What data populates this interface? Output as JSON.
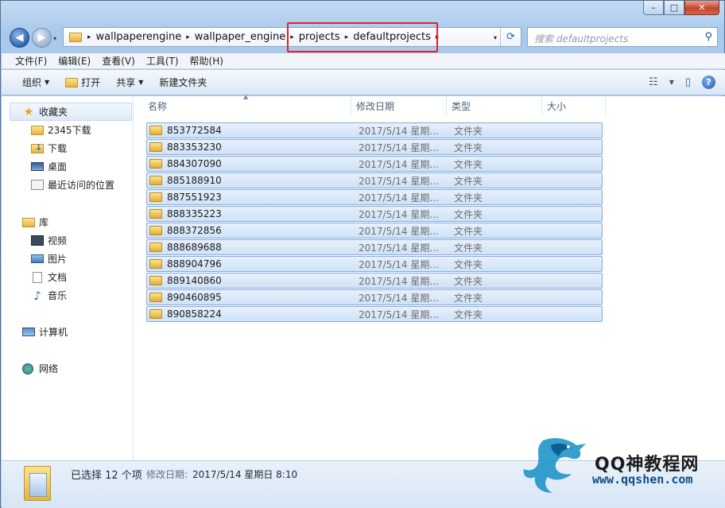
{
  "window": {
    "caption": {
      "minimize": "–",
      "maximize": "□",
      "close": "✕"
    }
  },
  "navigation": {
    "back": "◀",
    "forward": "▶",
    "history": "▾",
    "breadcrumbs": [
      "wallpaperengine",
      "wallpaper_engine",
      "projects",
      "defaultprojects"
    ],
    "separator": "▸",
    "dropdown": "▾",
    "refresh": "⟳",
    "search_placeholder": "搜索 defaultprojects"
  },
  "menubar": [
    "文件(F)",
    "编辑(E)",
    "查看(V)",
    "工具(T)",
    "帮助(H)"
  ],
  "commandbar": {
    "organize": "组织",
    "open": "打开",
    "share": "共享",
    "new_folder": "新建文件夹",
    "dropdown_arrow": "▼",
    "views_icon": "☷",
    "views_arrow": "▼",
    "preview_pane": "▯",
    "help": "?"
  },
  "nav_pane": {
    "favorites": {
      "label": "收藏夹",
      "items": [
        "2345下载",
        "下载",
        "桌面",
        "最近访问的位置"
      ]
    },
    "libraries": {
      "label": "库",
      "items": [
        "视频",
        "图片",
        "文档",
        "音乐"
      ]
    },
    "computer": {
      "label": "计算机"
    },
    "network": {
      "label": "网络"
    }
  },
  "columns": {
    "name": "名称",
    "date": "修改日期",
    "type": "类型",
    "size": "大小",
    "sort_indicator": "▲"
  },
  "files": [
    {
      "name": "853772584",
      "date": "2017/5/14 星期...",
      "type": "文件夹"
    },
    {
      "name": "883353230",
      "date": "2017/5/14 星期...",
      "type": "文件夹"
    },
    {
      "name": "884307090",
      "date": "2017/5/14 星期...",
      "type": "文件夹"
    },
    {
      "name": "885188910",
      "date": "2017/5/14 星期...",
      "type": "文件夹"
    },
    {
      "name": "887551923",
      "date": "2017/5/14 星期...",
      "type": "文件夹"
    },
    {
      "name": "888335223",
      "date": "2017/5/14 星期...",
      "type": "文件夹"
    },
    {
      "name": "888372856",
      "date": "2017/5/14 星期...",
      "type": "文件夹"
    },
    {
      "name": "888689688",
      "date": "2017/5/14 星期...",
      "type": "文件夹"
    },
    {
      "name": "888904796",
      "date": "2017/5/14 星期...",
      "type": "文件夹"
    },
    {
      "name": "889140860",
      "date": "2017/5/14 星期...",
      "type": "文件夹"
    },
    {
      "name": "890460895",
      "date": "2017/5/14 星期...",
      "type": "文件夹"
    },
    {
      "name": "890858224",
      "date": "2017/5/14 星期...",
      "type": "文件夹"
    }
  ],
  "status": {
    "selected": "已选择 12 个项",
    "modified_label": "修改日期:",
    "modified_value": "2017/5/14 星期日 8:10"
  },
  "watermark": {
    "title": "QQ神教程网",
    "url": "www.qqshen.com"
  },
  "colors": {
    "highlight_box": "#e0242a",
    "selection_fill": "#cfe2f7",
    "selection_border": "#84acdd"
  }
}
